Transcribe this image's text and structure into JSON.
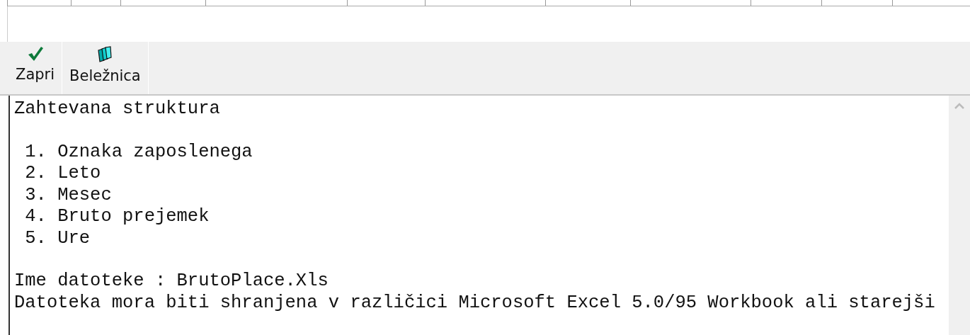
{
  "toolbar": [
    {
      "kind": "check",
      "label": "Zapri"
    },
    {
      "kind": "notebook",
      "label": "Beležnica"
    }
  ],
  "document": {
    "paragraphs": [
      [
        "Zahtevana struktura"
      ],
      [
        " 1. Oznaka zaposlenega",
        " 2. Leto",
        " 3. Mesec",
        " 4. Bruto prejemek",
        " 5. Ure"
      ],
      [
        "Ime datoteke : BrutoPlace.Xls",
        "Datoteka mora biti shranjena v različici Microsoft Excel 5.0/95 Workbook ali starejši"
      ]
    ]
  }
}
